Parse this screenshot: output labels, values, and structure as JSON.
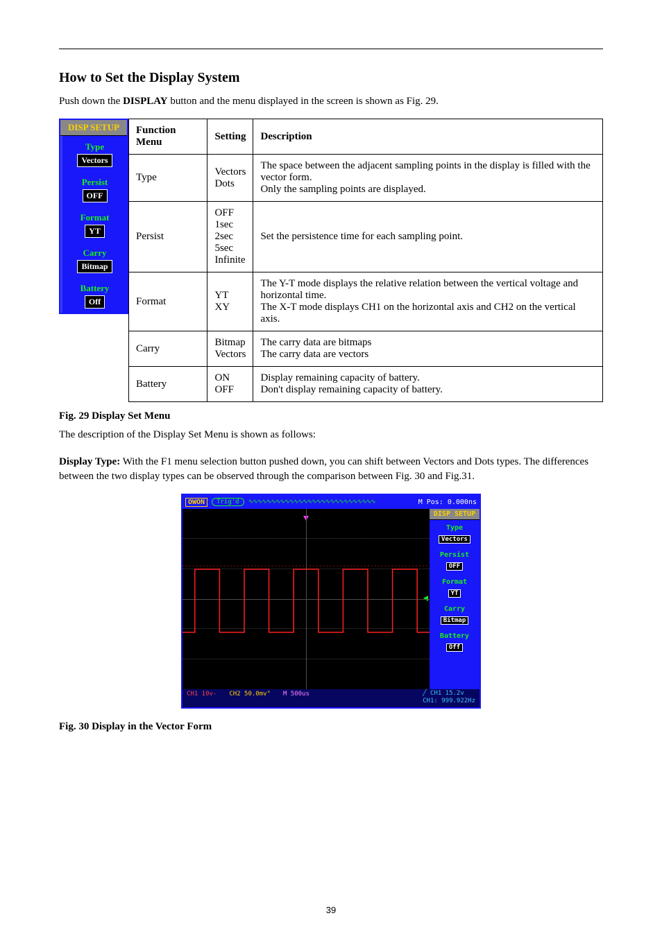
{
  "header": {},
  "section": {
    "title": "How to Set the Display System",
    "intro_prefix": "Push down the ",
    "intro_bold": "DISPLAY",
    "intro_suffix": " button and the menu displayed in the screen is shown as Fig. 29.",
    "fig29": "Fig. 29 Display Set Menu",
    "table_lead": "The description of the Display Set Menu is shown as follows:",
    "fig30": "Fig. 30 Display in the Vector Form"
  },
  "sidemenu": {
    "header": "DISP SETUP",
    "items": [
      {
        "label": "Type",
        "value": "Vectors"
      },
      {
        "label": "Persist",
        "value": "OFF"
      },
      {
        "label": "Format",
        "value": "YT"
      },
      {
        "label": "Carry",
        "value": "Bitmap"
      },
      {
        "label": "Battery",
        "value": "Off"
      }
    ]
  },
  "table": {
    "headers": [
      "Function Menu",
      "Setting",
      "Description"
    ],
    "rows": [
      [
        "Type",
        "Vectors\nDots",
        "The space between the adjacent sampling points in the display is filled with the vector form.\nOnly the sampling points are displayed."
      ],
      [
        "Persist",
        "OFF\n1sec\n2sec\n5sec\nInfinite",
        "Set the persistence time for each sampling point."
      ],
      [
        "Format",
        "YT\nXY",
        "The Y-T mode displays the relative relation between the vertical voltage and horizontal time.\nThe X-T mode displays CH1 on the horizontal axis and CH2 on the vertical axis."
      ],
      [
        "Carry",
        "Bitmap\nVectors",
        "The carry data are bitmaps\nThe carry data are vectors"
      ],
      [
        "Battery",
        "ON\nOFF",
        "Display remaining capacity of battery.\nDon't display remaining capacity of battery."
      ]
    ]
  },
  "displaytype": {
    "title": "Display Type:",
    "text": " With the F1 menu selection button pushed down, you can shift between Vectors and Dots types. The differences between the two display types can be observed through the comparison between Fig. 30 and Fig.31."
  },
  "scope": {
    "top": {
      "owon": "OWON",
      "trigd": "Trig'd",
      "mpos": "M Pos: 0.000ns"
    },
    "side": {
      "header": "DISP SETUP",
      "items": [
        {
          "label": "Type",
          "value": "Vectors"
        },
        {
          "label": "Persist",
          "value": "OFF"
        },
        {
          "label": "Format",
          "value": "YT"
        },
        {
          "label": "Carry",
          "value": "Bitmap"
        },
        {
          "label": "Battery",
          "value": "Off"
        }
      ]
    },
    "bottom": {
      "ch1": "CH1 10v-",
      "ch2": "CH2 50.0mv\"",
      "m": "M 500us",
      "r1": "CH1 15.2v",
      "r2": "CH1: 999.922Hz"
    }
  },
  "footer": "39"
}
